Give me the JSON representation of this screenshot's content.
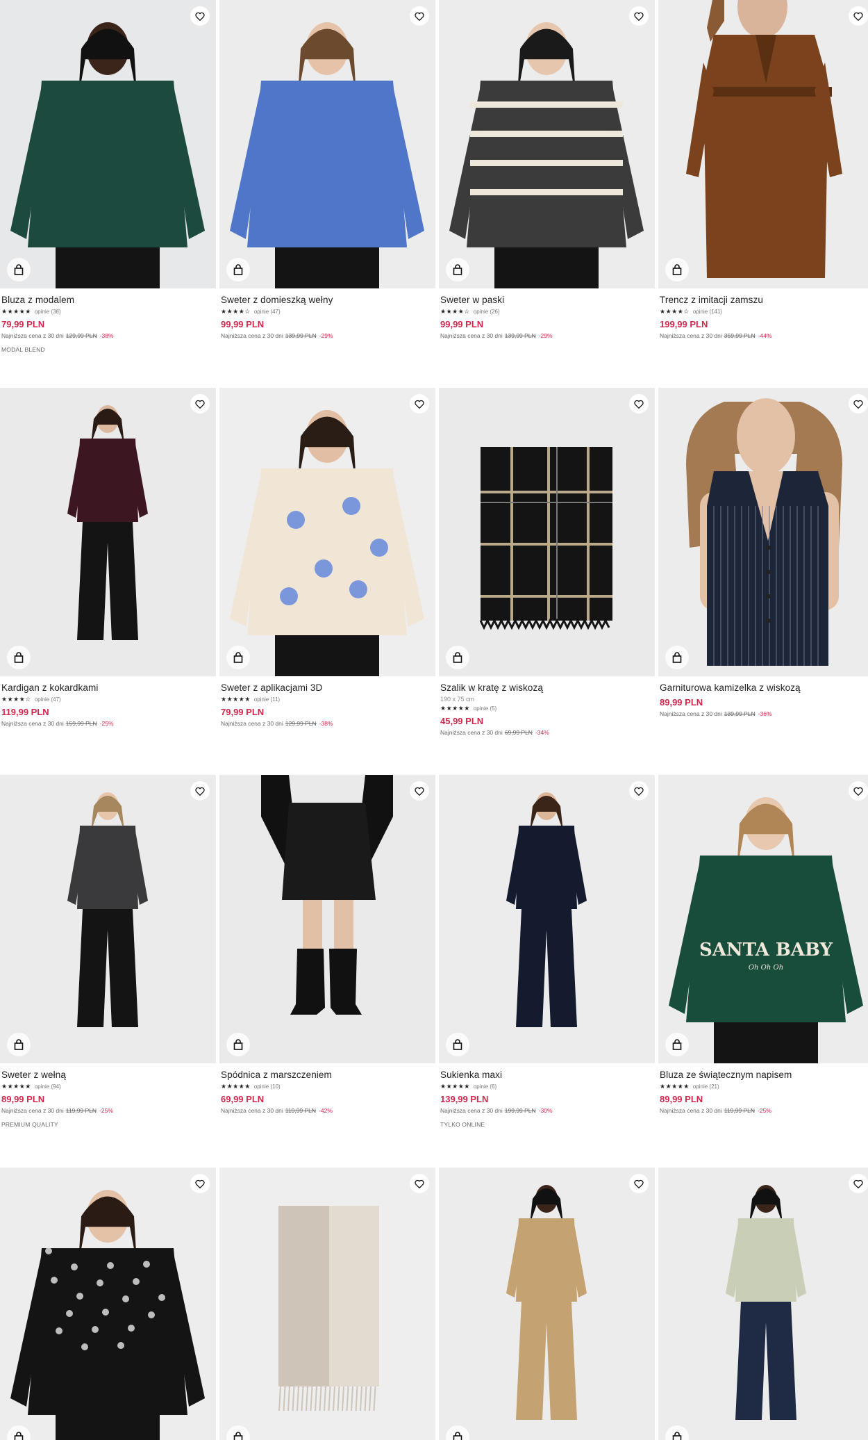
{
  "lowest_label": "Najniższa cena z 30 dni",
  "products": [
    {
      "name": "Bluza z modalem",
      "rating": "★★★★★",
      "reviews": "opinie (38)",
      "price": "79,99 PLN",
      "old_price": "129,99 PLN",
      "discount": "-38%",
      "tag": "MODAL BLEND",
      "colors": {
        "bg": "#e7e8ea",
        "garment": "#1d4a3f",
        "skin": "#3b2419",
        "hair": "#111111"
      }
    },
    {
      "name": "Sweter z domieszką wełny",
      "rating": "★★★★☆",
      "reviews": "opinie (47)",
      "price": "99,99 PLN",
      "old_price": "139,99 PLN",
      "discount": "-29%",
      "colors": {
        "bg": "#ececec",
        "garment": "#4f76c9",
        "skin": "#e6c2a8",
        "hair": "#6b4a2e"
      }
    },
    {
      "name": "Sweter w paski",
      "rating": "★★★★☆",
      "reviews": "opinie (26)",
      "price": "99,99 PLN",
      "old_price": "139,99 PLN",
      "discount": "-29%",
      "colors": {
        "bg": "#ececec",
        "garment": "#3b3b3b",
        "skin": "#e6c6ad",
        "hair": "#1a1a1a"
      }
    },
    {
      "name": "Trencz z imitacji zamszu",
      "rating": "★★★★☆",
      "reviews": "opinie (141)",
      "price": "199,99 PLN",
      "old_price": "359,99 PLN",
      "discount": "-44%",
      "colors": {
        "bg": "#ececec",
        "garment": "#7a431e",
        "skin": "#d9b49a",
        "hair": "#8a5a35"
      }
    },
    {
      "name": "Kardigan z kokardkami",
      "rating": "★★★★☆",
      "reviews": "opinie (47)",
      "price": "119,99 PLN",
      "old_price": "159,99 PLN",
      "discount": "-25%",
      "colors": {
        "bg": "#eaeaea",
        "garment": "#3c1620",
        "skin": "#dcb89e",
        "hair": "#2a1b14"
      }
    },
    {
      "name": "Sweter z aplikacjami 3D",
      "rating": "★★★★★",
      "reviews": "opinie (11)",
      "price": "79,99 PLN",
      "old_price": "129,99 PLN",
      "discount": "-38%",
      "colors": {
        "bg": "#eeeeee",
        "garment": "#f1e6d6",
        "skin": "#e2bfa4",
        "hair": "#2a1d15"
      }
    },
    {
      "name": "Szalik w kratę z wiskozą",
      "dims": "190 x 75 cm",
      "rating": "★★★★★",
      "reviews": "opinie (5)",
      "price": "45,99 PLN",
      "old_price": "69,99 PLN",
      "discount": "-34%",
      "colors": {
        "bg": "#eaeaea",
        "garment": "#141414",
        "skin": "#cdbb96",
        "hair": "#141414"
      }
    },
    {
      "name": "Garniturowa kamizelka z wiskozą",
      "price": "89,99 PLN",
      "old_price": "139,99 PLN",
      "discount": "-36%",
      "colors": {
        "bg": "#ececec",
        "garment": "#1d2538",
        "skin": "#e3c1a6",
        "hair": "#a47a52"
      }
    },
    {
      "name": "Sweter z wełną",
      "rating": "★★★★★",
      "reviews": "opinie (94)",
      "price": "89,99 PLN",
      "old_price": "119,99 PLN",
      "discount": "-25%",
      "tag": "PREMIUM QUALITY",
      "colors": {
        "bg": "#ebebeb",
        "garment": "#3a3a3c",
        "skin": "#e6c5ab",
        "hair": "#a6875e"
      }
    },
    {
      "name": "Spódnica z marszczeniem",
      "rating": "★★★★★",
      "reviews": "opinie (10)",
      "price": "69,99 PLN",
      "old_price": "119,99 PLN",
      "discount": "-42%",
      "colors": {
        "bg": "#eaeaea",
        "garment": "#1a1a1a",
        "skin": "#e2c0a5",
        "hair": "#111111"
      }
    },
    {
      "name": "Sukienka maxi",
      "rating": "★★★★★",
      "reviews": "opinie (6)",
      "price": "139,99 PLN",
      "old_price": "199,99 PLN",
      "discount": "-30%",
      "tag": "TYLKO ONLINE",
      "colors": {
        "bg": "#ececec",
        "garment": "#141b2e",
        "skin": "#dcb699",
        "hair": "#3a2518"
      }
    },
    {
      "name": "Bluza ze świątecznym napisem",
      "rating": "★★★★★",
      "reviews": "opinie (21)",
      "price": "89,99 PLN",
      "old_price": "119,99 PLN",
      "discount": "-25%",
      "print": {
        "line1": "SANTA BABY",
        "line2": "Oh Oh Oh"
      },
      "colors": {
        "bg": "#ececec",
        "garment": "#184d3c",
        "skin": "#e8c8ae",
        "hair": "#b08656"
      }
    },
    {
      "name": "",
      "colors": {
        "bg": "#ededed",
        "garment": "#141414",
        "skin": "#e4c2a8",
        "hair": "#2a1b14"
      }
    },
    {
      "name": "",
      "colors": {
        "bg": "#eeeeee",
        "garment": "#cfc4b8",
        "skin": "#e4c2a8",
        "hair": "#2a1b14"
      }
    },
    {
      "name": "",
      "colors": {
        "bg": "#ececec",
        "garment": "#c4a272",
        "skin": "#3b2419",
        "hair": "#111111"
      }
    },
    {
      "name": "",
      "colors": {
        "bg": "#ececec",
        "garment": "#c9cfb6",
        "skin": "#3b2419",
        "hair": "#111111"
      }
    }
  ]
}
